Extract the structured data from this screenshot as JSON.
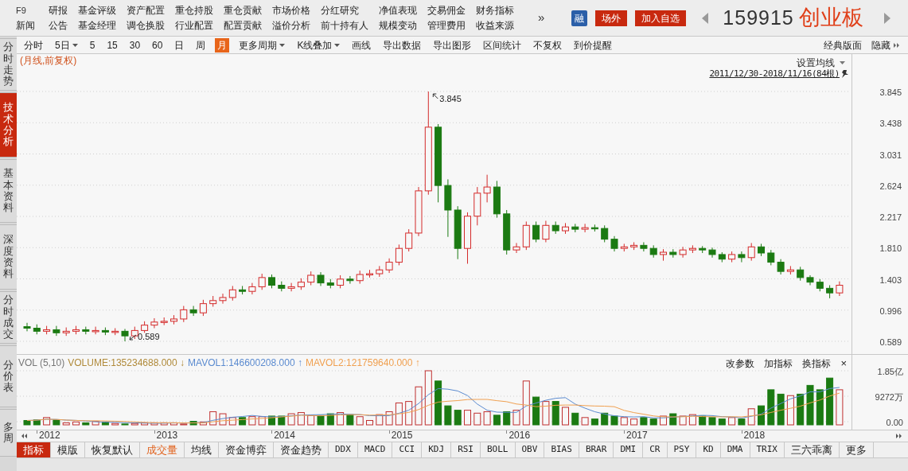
{
  "menu": [
    {
      "top": "F9",
      "bottom": "新闻"
    },
    {
      "top": "研报",
      "bottom": "公告"
    },
    {
      "top": "基金评级",
      "bottom": "基金经理"
    },
    {
      "top": "资产配置",
      "bottom": "调仓换股"
    },
    {
      "top": "重仓持股",
      "bottom": "行业配置"
    },
    {
      "top": "重仓贡献",
      "bottom": "配置贡献"
    },
    {
      "top": "市场价格",
      "bottom": "溢价分析"
    },
    {
      "top": "分红研究",
      "bottom": "前十持有人"
    },
    {
      "top": "净值表现",
      "bottom": "规模变动"
    },
    {
      "top": "交易佣金",
      "bottom": "管理费用"
    },
    {
      "top": "财务指标",
      "bottom": "收益来源"
    }
  ],
  "menu_more": "»",
  "badges": [
    {
      "label": "融",
      "kind": "margin"
    },
    {
      "label": "场外",
      "kind": "action"
    },
    {
      "label": "加入自选",
      "kind": "action"
    }
  ],
  "security": {
    "code": "159915",
    "name": "创业板"
  },
  "toolbar": [
    {
      "label": "分时",
      "selected": false,
      "dropdown": false
    },
    {
      "label": "5日",
      "selected": false,
      "dropdown": true
    },
    {
      "label": "5",
      "selected": false,
      "dropdown": false
    },
    {
      "label": "15",
      "selected": false,
      "dropdown": false
    },
    {
      "label": "30",
      "selected": false,
      "dropdown": false
    },
    {
      "label": "60",
      "selected": false,
      "dropdown": false
    },
    {
      "label": "日",
      "selected": false,
      "dropdown": false
    },
    {
      "label": "周",
      "selected": false,
      "dropdown": false
    },
    {
      "label": "月",
      "selected": true,
      "dropdown": false
    },
    {
      "label": "更多周期",
      "selected": false,
      "dropdown": true
    },
    {
      "label": "K线叠加",
      "selected": false,
      "dropdown": true
    },
    {
      "label": "画线",
      "selected": false,
      "dropdown": false
    },
    {
      "label": "导出数据",
      "selected": false,
      "dropdown": false
    },
    {
      "label": "导出图形",
      "selected": false,
      "dropdown": false
    },
    {
      "label": "区间统计",
      "selected": false,
      "dropdown": false
    },
    {
      "label": "不复权",
      "selected": false,
      "dropdown": false
    },
    {
      "label": "到价提醒",
      "selected": false,
      "dropdown": false
    }
  ],
  "view_links": [
    "经典版面",
    "隐藏"
  ],
  "side_tabs": [
    {
      "label": "分时走势",
      "selected": false
    },
    {
      "label": "技术分析",
      "selected": true
    },
    {
      "label": "基本资料",
      "selected": false
    },
    {
      "label": "深度资料",
      "selected": false
    },
    {
      "label": "分时成交",
      "selected": false
    },
    {
      "label": "分价表",
      "selected": false
    },
    {
      "label": "多周",
      "selected": false
    }
  ],
  "price_chart": {
    "caption": "(月线,前复权)",
    "ma_setting": "设置均线",
    "range": "2011/12/30-2018/11/16(84根)",
    "high_label": "3.845",
    "low_label": "0.589",
    "chart_data": {
      "type": "candlestick",
      "grid": true,
      "ohlc": [
        [
          0.78,
          0.83,
          0.72,
          0.76
        ],
        [
          0.76,
          0.81,
          0.68,
          0.72
        ],
        [
          0.72,
          0.79,
          0.68,
          0.74
        ],
        [
          0.74,
          0.79,
          0.66,
          0.7
        ],
        [
          0.7,
          0.77,
          0.66,
          0.72
        ],
        [
          0.72,
          0.79,
          0.68,
          0.74
        ],
        [
          0.74,
          0.78,
          0.68,
          0.72
        ],
        [
          0.72,
          0.78,
          0.68,
          0.73
        ],
        [
          0.73,
          0.77,
          0.67,
          0.71
        ],
        [
          0.71,
          0.76,
          0.67,
          0.72
        ],
        [
          0.72,
          0.75,
          0.589,
          0.66
        ],
        [
          0.66,
          0.78,
          0.62,
          0.73
        ],
        [
          0.73,
          0.85,
          0.7,
          0.8
        ],
        [
          0.8,
          0.89,
          0.76,
          0.84
        ],
        [
          0.84,
          0.9,
          0.8,
          0.85
        ],
        [
          0.85,
          0.93,
          0.81,
          0.88
        ],
        [
          0.88,
          1.05,
          0.84,
          1.0
        ],
        [
          1.0,
          1.05,
          0.92,
          0.96
        ],
        [
          0.96,
          1.13,
          0.92,
          1.08
        ],
        [
          1.08,
          1.18,
          1.04,
          1.12
        ],
        [
          1.12,
          1.21,
          1.08,
          1.16
        ],
        [
          1.16,
          1.31,
          1.12,
          1.26
        ],
        [
          1.26,
          1.31,
          1.2,
          1.24
        ],
        [
          1.24,
          1.35,
          1.2,
          1.3
        ],
        [
          1.3,
          1.47,
          1.26,
          1.42
        ],
        [
          1.42,
          1.46,
          1.28,
          1.32
        ],
        [
          1.32,
          1.37,
          1.24,
          1.28
        ],
        [
          1.28,
          1.35,
          1.24,
          1.3
        ],
        [
          1.3,
          1.41,
          1.26,
          1.36
        ],
        [
          1.36,
          1.5,
          1.32,
          1.45
        ],
        [
          1.45,
          1.49,
          1.31,
          1.35
        ],
        [
          1.35,
          1.4,
          1.28,
          1.32
        ],
        [
          1.32,
          1.45,
          1.28,
          1.4
        ],
        [
          1.4,
          1.44,
          1.34,
          1.38
        ],
        [
          1.38,
          1.51,
          1.34,
          1.46
        ],
        [
          1.46,
          1.52,
          1.42,
          1.47
        ],
        [
          1.47,
          1.57,
          1.43,
          1.52
        ],
        [
          1.52,
          1.67,
          1.48,
          1.62
        ],
        [
          1.62,
          1.85,
          1.58,
          1.8
        ],
        [
          1.8,
          2.05,
          1.76,
          2.0
        ],
        [
          2.0,
          2.6,
          1.96,
          2.55
        ],
        [
          2.55,
          3.845,
          2.5,
          3.38
        ],
        [
          3.38,
          3.42,
          2.4,
          2.62
        ],
        [
          2.62,
          2.7,
          1.95,
          2.3
        ],
        [
          2.3,
          2.35,
          1.66,
          1.8
        ],
        [
          1.8,
          2.27,
          1.6,
          2.22
        ],
        [
          2.22,
          2.6,
          2.1,
          2.52
        ],
        [
          2.52,
          2.76,
          2.4,
          2.6
        ],
        [
          2.6,
          2.68,
          2.2,
          2.25
        ],
        [
          2.25,
          2.3,
          1.72,
          1.78
        ],
        [
          1.78,
          1.87,
          1.74,
          1.82
        ],
        [
          1.82,
          2.15,
          1.78,
          2.1
        ],
        [
          2.1,
          2.15,
          1.88,
          1.92
        ],
        [
          1.92,
          2.16,
          1.88,
          2.1
        ],
        [
          2.1,
          2.15,
          1.99,
          2.03
        ],
        [
          2.03,
          2.13,
          1.99,
          2.08
        ],
        [
          2.08,
          2.12,
          2.01,
          2.05
        ],
        [
          2.05,
          2.12,
          2.01,
          2.07
        ],
        [
          2.07,
          2.11,
          2.02,
          2.06
        ],
        [
          2.06,
          2.1,
          1.88,
          1.92
        ],
        [
          1.92,
          1.96,
          1.76,
          1.8
        ],
        [
          1.8,
          1.86,
          1.76,
          1.82
        ],
        [
          1.82,
          1.88,
          1.78,
          1.84
        ],
        [
          1.84,
          1.88,
          1.76,
          1.8
        ],
        [
          1.8,
          1.84,
          1.68,
          1.72
        ],
        [
          1.72,
          1.79,
          1.64,
          1.75
        ],
        [
          1.75,
          1.79,
          1.68,
          1.72
        ],
        [
          1.72,
          1.82,
          1.68,
          1.78
        ],
        [
          1.78,
          1.84,
          1.74,
          1.8
        ],
        [
          1.8,
          1.83,
          1.74,
          1.78
        ],
        [
          1.78,
          1.81,
          1.68,
          1.72
        ],
        [
          1.72,
          1.75,
          1.62,
          1.66
        ],
        [
          1.66,
          1.76,
          1.62,
          1.72
        ],
        [
          1.72,
          1.76,
          1.62,
          1.68
        ],
        [
          1.68,
          1.87,
          1.64,
          1.82
        ],
        [
          1.82,
          1.86,
          1.7,
          1.74
        ],
        [
          1.74,
          1.78,
          1.58,
          1.62
        ],
        [
          1.62,
          1.66,
          1.46,
          1.5
        ],
        [
          1.5,
          1.57,
          1.46,
          1.52
        ],
        [
          1.52,
          1.56,
          1.38,
          1.42
        ],
        [
          1.42,
          1.45,
          1.32,
          1.36
        ],
        [
          1.36,
          1.4,
          1.24,
          1.28
        ],
        [
          1.28,
          1.32,
          1.15,
          1.22
        ],
        [
          1.22,
          1.37,
          1.18,
          1.32
        ]
      ],
      "ylim": [
        0.589,
        3.845
      ],
      "yticks": [
        {
          "value": 3.845,
          "label": "3.845"
        },
        {
          "value": 3.438,
          "label": "3.438"
        },
        {
          "value": 3.031,
          "label": "3.031"
        },
        {
          "value": 2.624,
          "label": "2.624"
        },
        {
          "value": 2.217,
          "label": "2.217"
        },
        {
          "value": 1.81,
          "label": "1.810"
        },
        {
          "value": 1.403,
          "label": "1.403"
        },
        {
          "value": 0.996,
          "label": "0.996"
        },
        {
          "value": 0.589,
          "label": "0.589"
        }
      ]
    }
  },
  "volume_pane": {
    "indicator": "VOL (5,10)",
    "readings": [
      {
        "text": "VOLUME:135234688.000",
        "arrow": "↓",
        "color": "#b08a3a"
      },
      {
        "text": "MAVOL1:146600208.000",
        "arrow": "↑",
        "color": "#5b8bd0"
      },
      {
        "text": "MAVOL2:121759640.000",
        "arrow": "↑",
        "color": "#f0a050"
      }
    ],
    "actions": [
      "改参数",
      "加指标",
      "换指标"
    ],
    "close": "×",
    "axis_labels": [
      "1.85亿",
      "9272万",
      "0.00"
    ]
  },
  "x_axis": {
    "labels": [
      "2012",
      "2013",
      "2014",
      "2015",
      "2016",
      "2017",
      "2018"
    ]
  },
  "indicator_tabs": [
    {
      "label": "指标",
      "selected": true,
      "active": false,
      "kind": "text"
    },
    {
      "label": "模版",
      "selected": false,
      "active": false,
      "kind": "text"
    },
    {
      "label": "恢复默认",
      "selected": false,
      "active": false,
      "kind": "text"
    },
    {
      "label": "成交量",
      "selected": false,
      "active": true,
      "kind": "text"
    },
    {
      "label": "均线",
      "selected": false,
      "active": false,
      "kind": "text"
    },
    {
      "label": "资金博弈",
      "selected": false,
      "active": false,
      "kind": "text"
    },
    {
      "label": "资金趋势",
      "selected": false,
      "active": false,
      "kind": "text"
    },
    {
      "label": "DDX",
      "selected": false,
      "active": false,
      "kind": "code"
    },
    {
      "label": "MACD",
      "selected": false,
      "active": false,
      "kind": "code"
    },
    {
      "label": "CCI",
      "selected": false,
      "active": false,
      "kind": "code"
    },
    {
      "label": "KDJ",
      "selected": false,
      "active": false,
      "kind": "code"
    },
    {
      "label": "RSI",
      "selected": false,
      "active": false,
      "kind": "code"
    },
    {
      "label": "BOLL",
      "selected": false,
      "active": false,
      "kind": "code"
    },
    {
      "label": "OBV",
      "selected": false,
      "active": false,
      "kind": "code"
    },
    {
      "label": "BIAS",
      "selected": false,
      "active": false,
      "kind": "code"
    },
    {
      "label": "BRAR",
      "selected": false,
      "active": false,
      "kind": "code"
    },
    {
      "label": "DMI",
      "selected": false,
      "active": false,
      "kind": "code"
    },
    {
      "label": "CR",
      "selected": false,
      "active": false,
      "kind": "code"
    },
    {
      "label": "PSY",
      "selected": false,
      "active": false,
      "kind": "code"
    },
    {
      "label": "KD",
      "selected": false,
      "active": false,
      "kind": "code"
    },
    {
      "label": "DMA",
      "selected": false,
      "active": false,
      "kind": "code"
    },
    {
      "label": "TRIX",
      "selected": false,
      "active": false,
      "kind": "code"
    },
    {
      "label": "三六乖离",
      "selected": false,
      "active": false,
      "kind": "text"
    },
    {
      "label": "更多",
      "selected": false,
      "active": false,
      "kind": "text"
    }
  ]
}
